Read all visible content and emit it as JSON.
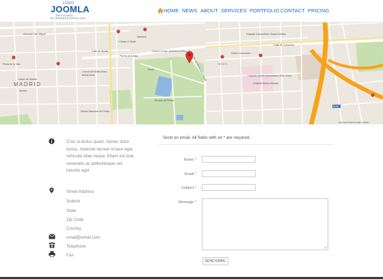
{
  "logo": {
    "top": "LOGO",
    "main": "JOOMLA",
    "sub": "DESIGNED",
    "tag": "BY WINNERSTEPHOLOGY"
  },
  "nav": {
    "items": [
      "HOME",
      "NEWS",
      "ABOUT",
      "SERVICES",
      "PORTFOLIO",
      "CONTACT",
      "PRICING"
    ]
  },
  "map": {
    "district": "MADRID",
    "labels": {
      "mercado": "Mercado San Miguel",
      "nacional": "Nacional",
      "library": "Library of Spain",
      "hospital": "Hospital Universitario Santa Cristina",
      "convencion": "Hotel Convención",
      "church": "Church of San Jerónimo el Real",
      "alcala": "Puerta de Alcalá",
      "prado": "Prado",
      "plaza_bellas": "Círculo de Bellas Artes",
      "bellas": "Bellas Artes",
      "casino": "Casino de Madrid",
      "sevilla": "Sevilla",
      "plaza_villa": "Plaza de la Villa",
      "parque": "Parque del Retiro",
      "museo": "Museo Nacional del Prado",
      "hosp2": "Hospital Infantil Universitario Niño Jesús",
      "hosp3": "Hospital Ibérica Madrid",
      "ibiza": "IBIZA",
      "calle_alcala": "Calle de Alcalá",
      "calle_odonnell": "Calle de O'Donnell",
      "calle_menendez": "Av. de Menéndez Pelayo",
      "m30": "M-30",
      "copyright": "Map data ©2014 Google, basado"
    }
  },
  "contact": {
    "description": "Cras ut lectus quam. Donec dolor lectus, molestie laoreet ornare eget, vehicula vitae neque. Etiam est erat, venenatis ac pellentesque vel, lobortis eget",
    "address": [
      "Street Address",
      "Suburb",
      "State",
      "Zip Code",
      "Country"
    ],
    "email": "email@email.com",
    "telephone": "Telephone",
    "fax": "Fax"
  },
  "form": {
    "title": "Send an email. All fields with an * are required.",
    "name_label": "Name *",
    "email_label": "Email *",
    "subject_label": "Subject *",
    "message_label": "Message *",
    "send_label": "SEND EMAIL"
  }
}
